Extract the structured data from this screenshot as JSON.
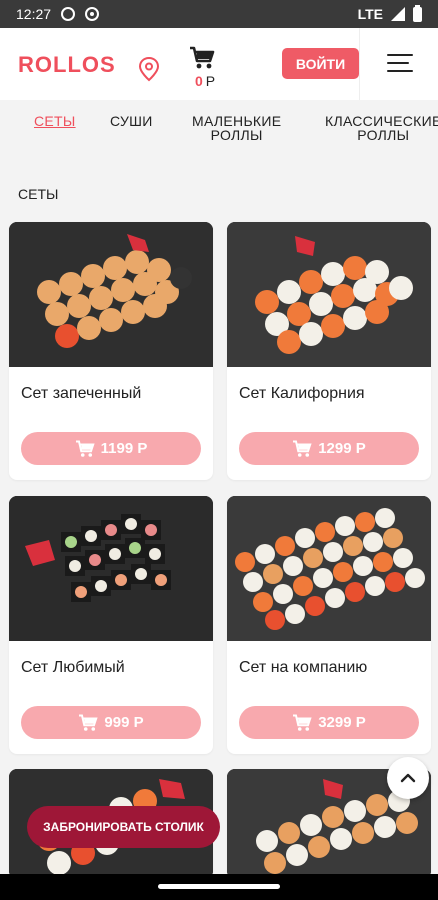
{
  "status": {
    "time": "12:27",
    "network": "LTE"
  },
  "header": {
    "logo": "ROLLOS",
    "cart_amount": "0",
    "cart_currency": "Р",
    "login": "ВОЙТИ"
  },
  "tabs": [
    {
      "line1": "СЕТЫ",
      "line2": ""
    },
    {
      "line1": "СУШИ",
      "line2": ""
    },
    {
      "line1": "МАЛЕНЬКИЕ",
      "line2": "РОЛЛЫ"
    },
    {
      "line1": "КЛАССИЧЕСКИЕ",
      "line2": "РОЛЛЫ"
    }
  ],
  "section_title": "СЕТЫ",
  "products": [
    {
      "name": "Сет запеченный",
      "price": "1199 Р"
    },
    {
      "name": "Сет Калифорния",
      "price": "1299 Р"
    },
    {
      "name": "Сет Любимый",
      "price": "999 Р"
    },
    {
      "name": "Сет на компанию",
      "price": "3299 Р"
    },
    {
      "name": "",
      "price": ""
    },
    {
      "name": "",
      "price": ""
    }
  ],
  "book_button": "ЗАБРОНИРОВАТЬ СТОЛИК",
  "colors": {
    "accent": "#ef4f5c",
    "price_button": "#f8a9ae",
    "book_button": "#9e1737"
  },
  "icons": [
    "location-pin-icon",
    "cart-icon",
    "menu-icon",
    "chevron-up-icon"
  ]
}
